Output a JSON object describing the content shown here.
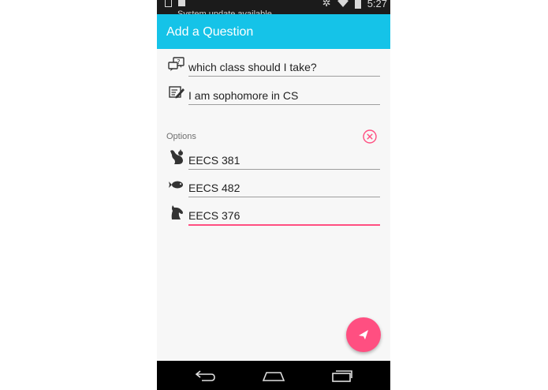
{
  "statusbar": {
    "notification_text": "System update available",
    "time": "5:27"
  },
  "appbar": {
    "title": "Add a Question"
  },
  "form": {
    "question": {
      "icon": "question-bubble-icon",
      "value": "which class should I take?"
    },
    "description": {
      "icon": "edit-note-icon",
      "value": "I am sophomore in CS"
    },
    "options_label": "Options",
    "options": [
      {
        "icon": "squirrel-icon",
        "value": "EECS 381"
      },
      {
        "icon": "fish-icon",
        "value": "EECS 482"
      },
      {
        "icon": "horse-icon",
        "value": "EECS 376"
      }
    ]
  },
  "fab": {
    "icon": "send-icon"
  },
  "navbar": {
    "buttons": [
      "back-icon",
      "home-icon",
      "recents-icon"
    ]
  },
  "colors": {
    "appbar": "#15c3e8",
    "accent": "#ff4f81",
    "background": "#f7f7f7"
  }
}
